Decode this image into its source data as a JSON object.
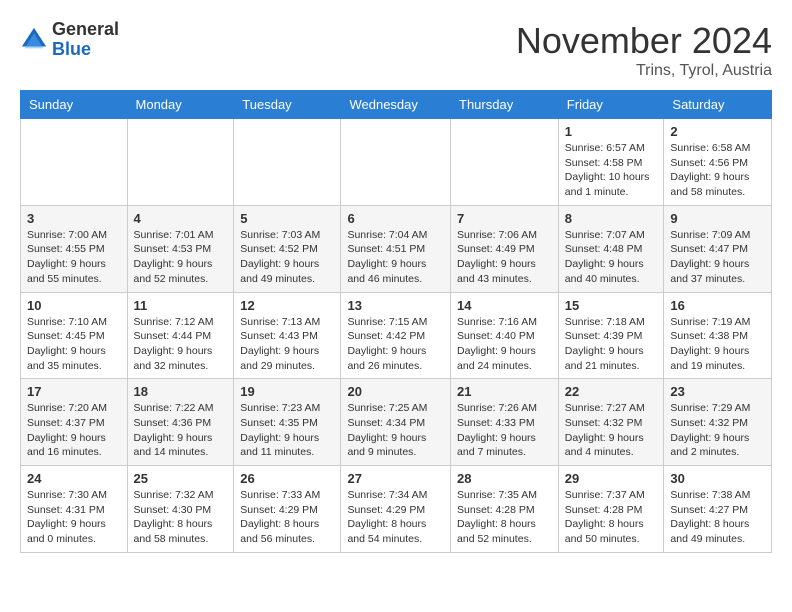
{
  "logo": {
    "general": "General",
    "blue": "Blue"
  },
  "title": {
    "month": "November 2024",
    "location": "Trins, Tyrol, Austria"
  },
  "headers": [
    "Sunday",
    "Monday",
    "Tuesday",
    "Wednesday",
    "Thursday",
    "Friday",
    "Saturday"
  ],
  "rows": [
    [
      {
        "day": "",
        "detail": ""
      },
      {
        "day": "",
        "detail": ""
      },
      {
        "day": "",
        "detail": ""
      },
      {
        "day": "",
        "detail": ""
      },
      {
        "day": "",
        "detail": ""
      },
      {
        "day": "1",
        "detail": "Sunrise: 6:57 AM\nSunset: 4:58 PM\nDaylight: 10 hours and 1 minute."
      },
      {
        "day": "2",
        "detail": "Sunrise: 6:58 AM\nSunset: 4:56 PM\nDaylight: 9 hours and 58 minutes."
      }
    ],
    [
      {
        "day": "3",
        "detail": "Sunrise: 7:00 AM\nSunset: 4:55 PM\nDaylight: 9 hours and 55 minutes."
      },
      {
        "day": "4",
        "detail": "Sunrise: 7:01 AM\nSunset: 4:53 PM\nDaylight: 9 hours and 52 minutes."
      },
      {
        "day": "5",
        "detail": "Sunrise: 7:03 AM\nSunset: 4:52 PM\nDaylight: 9 hours and 49 minutes."
      },
      {
        "day": "6",
        "detail": "Sunrise: 7:04 AM\nSunset: 4:51 PM\nDaylight: 9 hours and 46 minutes."
      },
      {
        "day": "7",
        "detail": "Sunrise: 7:06 AM\nSunset: 4:49 PM\nDaylight: 9 hours and 43 minutes."
      },
      {
        "day": "8",
        "detail": "Sunrise: 7:07 AM\nSunset: 4:48 PM\nDaylight: 9 hours and 40 minutes."
      },
      {
        "day": "9",
        "detail": "Sunrise: 7:09 AM\nSunset: 4:47 PM\nDaylight: 9 hours and 37 minutes."
      }
    ],
    [
      {
        "day": "10",
        "detail": "Sunrise: 7:10 AM\nSunset: 4:45 PM\nDaylight: 9 hours and 35 minutes."
      },
      {
        "day": "11",
        "detail": "Sunrise: 7:12 AM\nSunset: 4:44 PM\nDaylight: 9 hours and 32 minutes."
      },
      {
        "day": "12",
        "detail": "Sunrise: 7:13 AM\nSunset: 4:43 PM\nDaylight: 9 hours and 29 minutes."
      },
      {
        "day": "13",
        "detail": "Sunrise: 7:15 AM\nSunset: 4:42 PM\nDaylight: 9 hours and 26 minutes."
      },
      {
        "day": "14",
        "detail": "Sunrise: 7:16 AM\nSunset: 4:40 PM\nDaylight: 9 hours and 24 minutes."
      },
      {
        "day": "15",
        "detail": "Sunrise: 7:18 AM\nSunset: 4:39 PM\nDaylight: 9 hours and 21 minutes."
      },
      {
        "day": "16",
        "detail": "Sunrise: 7:19 AM\nSunset: 4:38 PM\nDaylight: 9 hours and 19 minutes."
      }
    ],
    [
      {
        "day": "17",
        "detail": "Sunrise: 7:20 AM\nSunset: 4:37 PM\nDaylight: 9 hours and 16 minutes."
      },
      {
        "day": "18",
        "detail": "Sunrise: 7:22 AM\nSunset: 4:36 PM\nDaylight: 9 hours and 14 minutes."
      },
      {
        "day": "19",
        "detail": "Sunrise: 7:23 AM\nSunset: 4:35 PM\nDaylight: 9 hours and 11 minutes."
      },
      {
        "day": "20",
        "detail": "Sunrise: 7:25 AM\nSunset: 4:34 PM\nDaylight: 9 hours and 9 minutes."
      },
      {
        "day": "21",
        "detail": "Sunrise: 7:26 AM\nSunset: 4:33 PM\nDaylight: 9 hours and 7 minutes."
      },
      {
        "day": "22",
        "detail": "Sunrise: 7:27 AM\nSunset: 4:32 PM\nDaylight: 9 hours and 4 minutes."
      },
      {
        "day": "23",
        "detail": "Sunrise: 7:29 AM\nSunset: 4:32 PM\nDaylight: 9 hours and 2 minutes."
      }
    ],
    [
      {
        "day": "24",
        "detail": "Sunrise: 7:30 AM\nSunset: 4:31 PM\nDaylight: 9 hours and 0 minutes."
      },
      {
        "day": "25",
        "detail": "Sunrise: 7:32 AM\nSunset: 4:30 PM\nDaylight: 8 hours and 58 minutes."
      },
      {
        "day": "26",
        "detail": "Sunrise: 7:33 AM\nSunset: 4:29 PM\nDaylight: 8 hours and 56 minutes."
      },
      {
        "day": "27",
        "detail": "Sunrise: 7:34 AM\nSunset: 4:29 PM\nDaylight: 8 hours and 54 minutes."
      },
      {
        "day": "28",
        "detail": "Sunrise: 7:35 AM\nSunset: 4:28 PM\nDaylight: 8 hours and 52 minutes."
      },
      {
        "day": "29",
        "detail": "Sunrise: 7:37 AM\nSunset: 4:28 PM\nDaylight: 8 hours and 50 minutes."
      },
      {
        "day": "30",
        "detail": "Sunrise: 7:38 AM\nSunset: 4:27 PM\nDaylight: 8 hours and 49 minutes."
      }
    ]
  ]
}
